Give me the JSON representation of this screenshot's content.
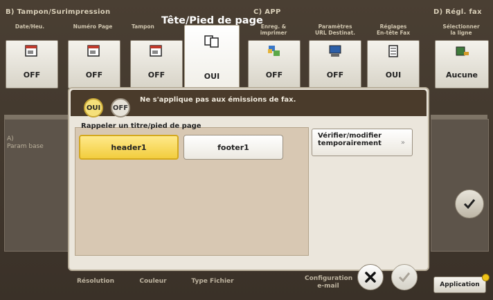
{
  "header": {
    "group_b": "B)  Tampon/Surimpression",
    "group_c": "C)  APP",
    "group_d": "D)  Régl. fax"
  },
  "popup_title": "Tête/Pied de page",
  "tiles": [
    {
      "label": "Date/Heu.",
      "value": "OFF",
      "icon": "calendar-icon"
    },
    {
      "label": "Numéro Page",
      "value": "OFF",
      "icon": "page-number-icon"
    },
    {
      "label": "Tampon",
      "value": "OFF",
      "icon": "stamp-icon"
    },
    {
      "label": "",
      "value": "OUI",
      "icon": "header-footer-icon"
    },
    {
      "label": "Enreg. &\nimprimer",
      "value": "OFF",
      "icon": "save-print-icon"
    },
    {
      "label": "Paramètres\nURL Destinat.",
      "value": "OFF",
      "icon": "url-destination-icon"
    },
    {
      "label": "Réglages\nEn-tête Fax",
      "value": "OUI",
      "icon": "fax-header-icon"
    },
    {
      "label": "Sélectionner\nla ligne",
      "value": "Aucune",
      "icon": "fax-line-icon"
    }
  ],
  "background": {
    "left_panel_text": "A)\nParam base"
  },
  "dialog": {
    "toggle_on": "OUI",
    "toggle_off": "OFF",
    "note": "Ne s'applique pas aux émissions de fax.",
    "recall_label": "Rappeler un titre/pied de page",
    "option_header": "header1",
    "option_footer": "footer1",
    "verify_button": "Vérifier/modifier\ntemporairement",
    "verify_arrow": "»"
  },
  "bottom_bar": {
    "resolution": "Résolution",
    "color": "Couleur",
    "file_type": "Type Fichier",
    "email_config": "Configuration\ne-mail",
    "application": "Application"
  },
  "colors": {
    "accent_yellow": "#f2cd3e",
    "header_bg": "#4a3b2b"
  }
}
